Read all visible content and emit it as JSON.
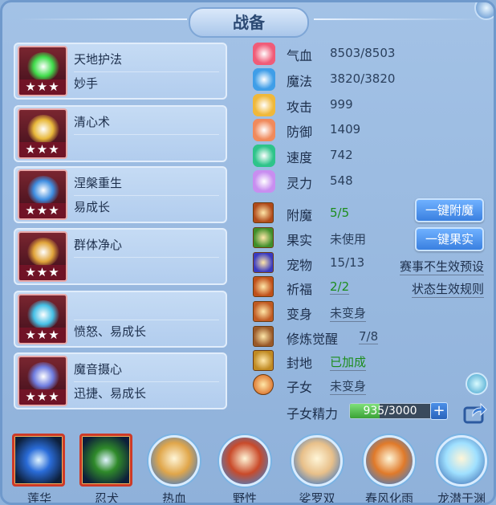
{
  "title": "战备",
  "skills": [
    {
      "name": "天地护法",
      "tag": "妙手",
      "stars": "★★★",
      "color": "#3fdc4a"
    },
    {
      "name": "清心术",
      "tag": "",
      "stars": "★★★",
      "color": "#e8b83a"
    },
    {
      "name": "涅槃重生",
      "tag": "易成长",
      "stars": "★★★",
      "color": "#3e8de0"
    },
    {
      "name": "群体净心",
      "tag": "",
      "stars": "★★★",
      "color": "#e0a43a"
    },
    {
      "name": "",
      "tag": "愤怒、易成长",
      "stars": "★★★",
      "color": "#45c0e6"
    },
    {
      "name": "魔音摄心",
      "tag": "迅捷、易成长",
      "stars": "★★★",
      "color": "#6f7de0"
    }
  ],
  "stats": [
    {
      "label": "气血",
      "value": "8503/8503",
      "icon": "heart-icon",
      "color": "#f05c78"
    },
    {
      "label": "魔法",
      "value": "3820/3820",
      "icon": "mana-icon",
      "color": "#3f9ee8"
    },
    {
      "label": "攻击",
      "value": "999",
      "icon": "sword-icon",
      "color": "#f0b83a"
    },
    {
      "label": "防御",
      "value": "1409",
      "icon": "shield-icon",
      "color": "#f08a5c"
    },
    {
      "label": "速度",
      "value": "742",
      "icon": "speed-icon",
      "color": "#2ec48a"
    },
    {
      "label": "灵力",
      "value": "548",
      "icon": "spirit-icon",
      "color": "#c88ef0"
    }
  ],
  "features": [
    {
      "label": "附魔",
      "value": "5/5",
      "icon": "enchant-icon"
    },
    {
      "label": "果实",
      "value": "未使用",
      "icon": "fruit-icon"
    },
    {
      "label": "宠物",
      "value": "15/13",
      "icon": "pet-icon"
    },
    {
      "label": "祈福",
      "value": "2/2",
      "icon": "blessing-icon"
    },
    {
      "label": "变身",
      "value": "未变身",
      "icon": "transform-icon"
    },
    {
      "label": "修炼觉醒",
      "value": "7/8",
      "icon": "cultivation-icon"
    },
    {
      "label": "封地",
      "value": "已加成",
      "icon": "fief-icon"
    },
    {
      "label": "子女",
      "value": "未变身",
      "icon": "child-icon"
    }
  ],
  "buttons": {
    "enchant": "一键附魔",
    "fruit": "一键果实"
  },
  "links": {
    "event_preset": "赛事不生效预设",
    "status_rules": "状态生效规则"
  },
  "child_essence": {
    "label": "子女精力",
    "value": "935/3000",
    "current": 935,
    "max": 3000
  },
  "bottom_skills": [
    {
      "label": "莲华",
      "style": "square",
      "color": "#2a6cd8"
    },
    {
      "label": "忍犬",
      "style": "square",
      "color": "#2f8a2a"
    },
    {
      "label": "热血",
      "style": "round",
      "color": "#e0a64a"
    },
    {
      "label": "野性",
      "style": "round",
      "color": "#c94a2a"
    },
    {
      "label": "娑罗双",
      "style": "round",
      "color": "#e8c08a"
    },
    {
      "label": "春风化雨",
      "style": "round",
      "color": "#e07a2a"
    },
    {
      "label": "龙潜于渊",
      "style": "round",
      "color": "#9fe0ff"
    }
  ]
}
